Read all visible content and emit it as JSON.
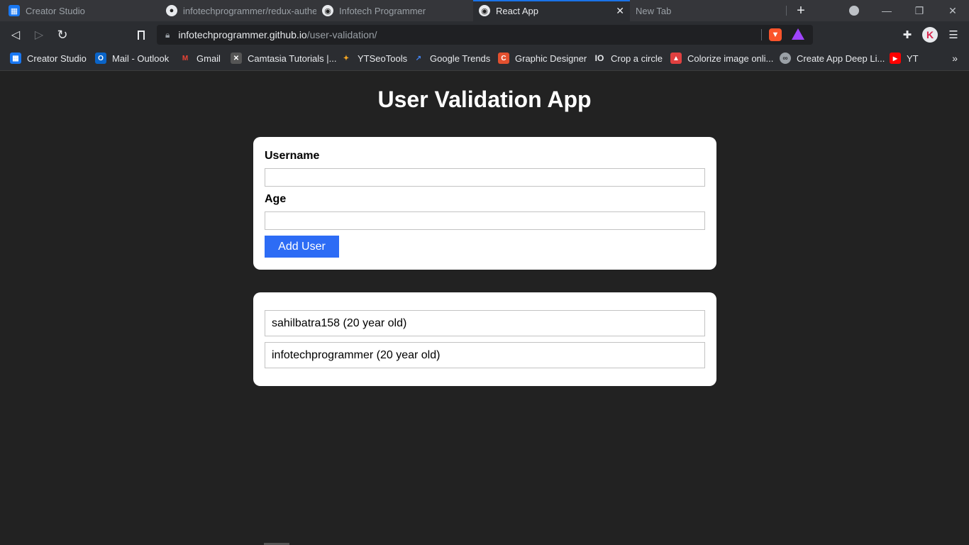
{
  "browser": {
    "tabs": [
      {
        "title": "Creator Studio",
        "icon": "creator-studio-icon",
        "active": false
      },
      {
        "title": "infotechprogrammer/redux-authe",
        "icon": "github-icon",
        "active": false
      },
      {
        "title": "Infotech Programmer",
        "icon": "infotech-icon",
        "active": false
      },
      {
        "title": "React App",
        "icon": "infotech-icon",
        "active": true
      },
      {
        "title": "New Tab",
        "icon": "",
        "active": false
      }
    ],
    "new_tab_symbol": "+",
    "tab_close_symbol": "✕",
    "url_host": "infotechprogrammer.github.io",
    "url_path": "/user-validation/",
    "bookmarks": [
      {
        "label": "Creator Studio",
        "icon": "creator-studio-icon",
        "color": "#1877f2",
        "glyph": "▦"
      },
      {
        "label": "Mail - Outlook",
        "icon": "outlook-icon",
        "color": "#0a64c8",
        "glyph": "O"
      },
      {
        "label": "Gmail",
        "icon": "gmail-icon",
        "color": "#2b2d31",
        "glyph": "M"
      },
      {
        "label": "Camtasia Tutorials |...",
        "icon": "camtasia-icon",
        "color": "#555555",
        "glyph": "✕"
      },
      {
        "label": "YTSeoTools",
        "icon": "ytseotools-icon",
        "color": "#2b2d31",
        "glyph": "✦"
      },
      {
        "label": "Google Trends",
        "icon": "google-trends-icon",
        "color": "#2b2d31",
        "glyph": "↗"
      },
      {
        "label": "Graphic Designer",
        "icon": "graphic-designer-icon",
        "color": "#e2502f",
        "glyph": "C"
      },
      {
        "label": "Crop a circle",
        "icon": "crop-circle-icon",
        "color": "#2b2d31",
        "glyph": "IO"
      },
      {
        "label": "Colorize image onli...",
        "icon": "colorize-icon",
        "color": "#e04040",
        "glyph": "▲"
      },
      {
        "label": "Create App Deep Li...",
        "icon": "deep-link-icon",
        "color": "#9aa0a6",
        "glyph": "∞"
      },
      {
        "label": "YT",
        "icon": "youtube-icon",
        "color": "#ff0000",
        "glyph": "▶"
      }
    ],
    "more_bookmarks_symbol": "»"
  },
  "app": {
    "title": "User Validation App",
    "form": {
      "username_label": "Username",
      "username_value": "",
      "age_label": "Age",
      "age_value": "",
      "submit_label": "Add User"
    },
    "users": [
      {
        "text": "sahilbatra158 (20 year old)"
      },
      {
        "text": "infotechprogrammer (20 year old)"
      }
    ]
  },
  "colors": {
    "page_bg": "#222222",
    "card_bg": "#ffffff",
    "button_bg": "#2d6cf5",
    "active_tab_accent": "#1a73e8"
  }
}
